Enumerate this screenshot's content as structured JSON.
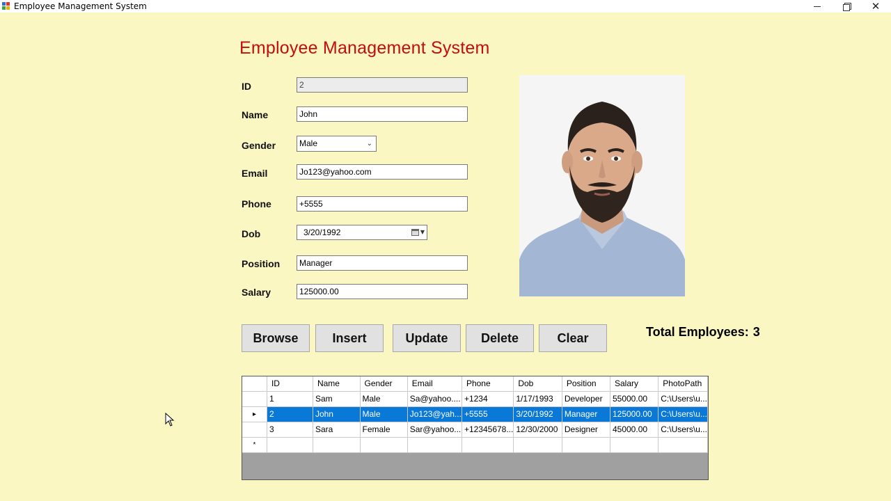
{
  "window": {
    "title": "Employee Management System"
  },
  "header": {
    "title": "Employee Management System"
  },
  "form": {
    "id": {
      "label": "ID",
      "value": "2"
    },
    "name": {
      "label": "Name",
      "value": "John"
    },
    "gender": {
      "label": "Gender",
      "value": "Male"
    },
    "email": {
      "label": "Email",
      "value": "Jo123@yahoo.com"
    },
    "phone": {
      "label": "Phone",
      "value": "+5555"
    },
    "dob": {
      "label": "Dob",
      "value": "3/20/1992"
    },
    "position": {
      "label": "Position",
      "value": "Manager"
    },
    "salary": {
      "label": "Salary",
      "value": "125000.00"
    }
  },
  "buttons": {
    "browse": "Browse",
    "insert": "Insert",
    "update": "Update",
    "delete": "Delete",
    "clear": "Clear"
  },
  "summary": {
    "label": "Total Employees:",
    "count": "3"
  },
  "grid": {
    "columns": [
      "ID",
      "Name",
      "Gender",
      "Email",
      "Phone",
      "Dob",
      "Position",
      "Salary",
      "PhotoPath"
    ],
    "rows": [
      [
        "1",
        "Sam",
        "Male",
        "Sa@yahoo....",
        "+1234",
        "1/17/1993",
        "Developer",
        "55000.00",
        "C:\\Users\\u..."
      ],
      [
        "2",
        "John",
        "Male",
        "Jo123@yah...",
        "+5555",
        "3/20/1992",
        "Manager",
        "125000.00",
        "C:\\Users\\u..."
      ],
      [
        "3",
        "Sara",
        "Female",
        "Sar@yahoo...",
        "+12345678...",
        "12/30/2000",
        "Designer",
        "45000.00",
        "C:\\Users\\u..."
      ]
    ],
    "selected_row": 1,
    "selected_marker": "▸",
    "new_row_marker": "*"
  },
  "icons": {
    "app": "app-icon",
    "minimize": "minimize-icon",
    "maximize": "restore-icon",
    "close": "close-icon"
  },
  "colors": {
    "background": "#fbf7c3",
    "title": "#c40d0d",
    "selection": "#0a78d7"
  }
}
